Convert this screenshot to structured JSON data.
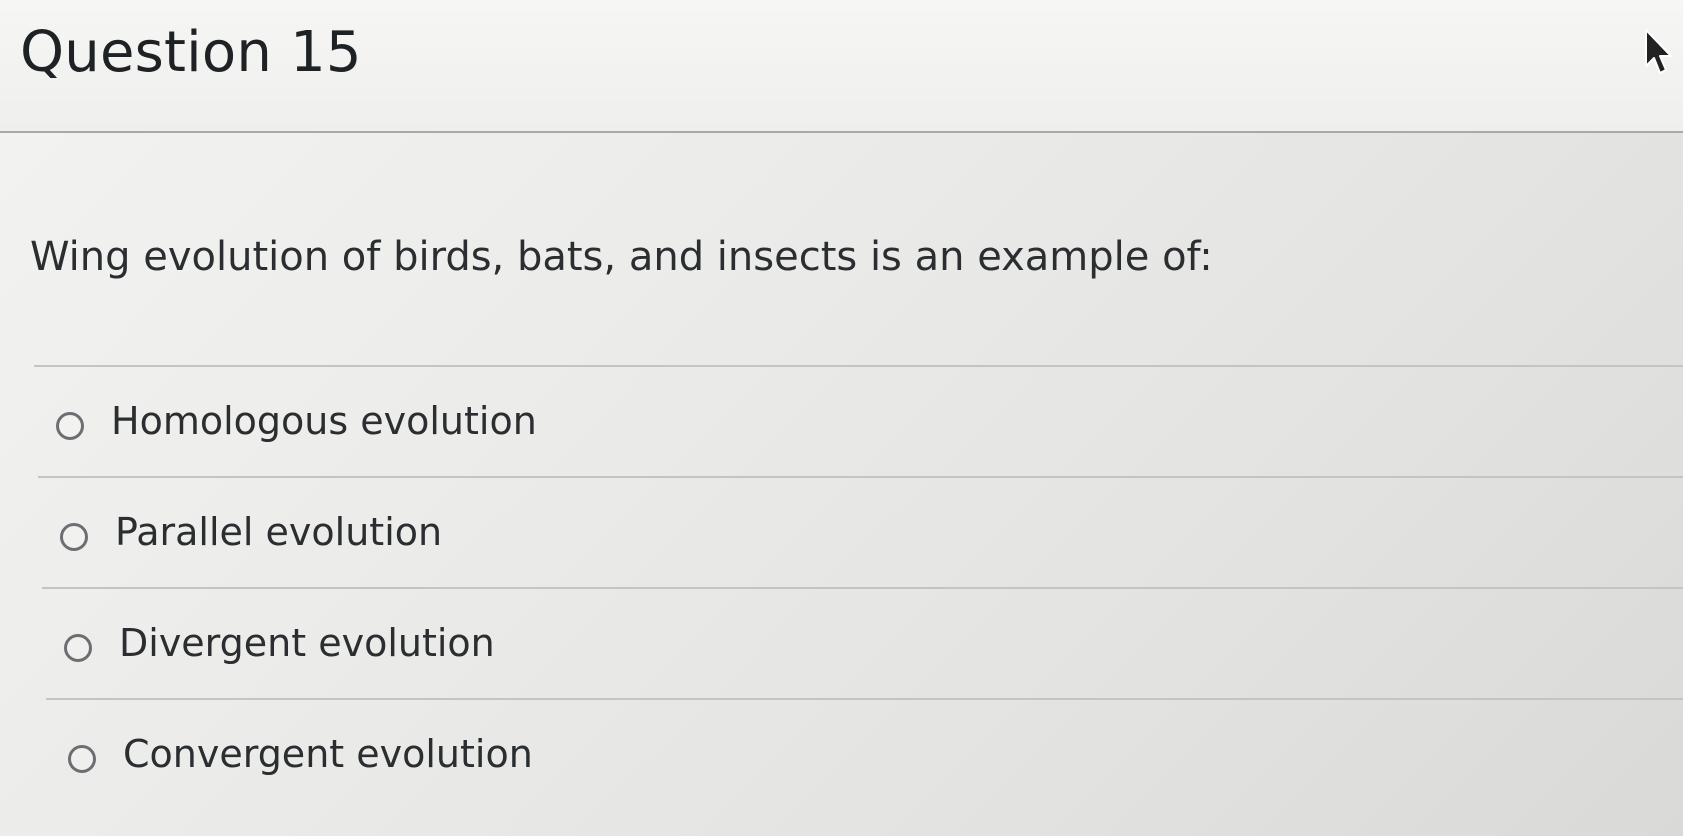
{
  "question": {
    "title": "Question 15",
    "prompt": "Wing evolution of birds, bats, and insects is an example of:",
    "options": [
      {
        "label": "Homologous evolution"
      },
      {
        "label": "Parallel evolution"
      },
      {
        "label": "Divergent evolution"
      },
      {
        "label": "Convergent evolution"
      }
    ]
  },
  "icons": {
    "option_radio": "radio-unselected-icon",
    "cursor": "mouse-pointer-icon"
  },
  "colors": {
    "background": "#ececea",
    "text": "#2b2e30",
    "divider": "#c4c5c3",
    "header_rule": "#a8aaa8",
    "radio_border": "#6c6f71"
  }
}
